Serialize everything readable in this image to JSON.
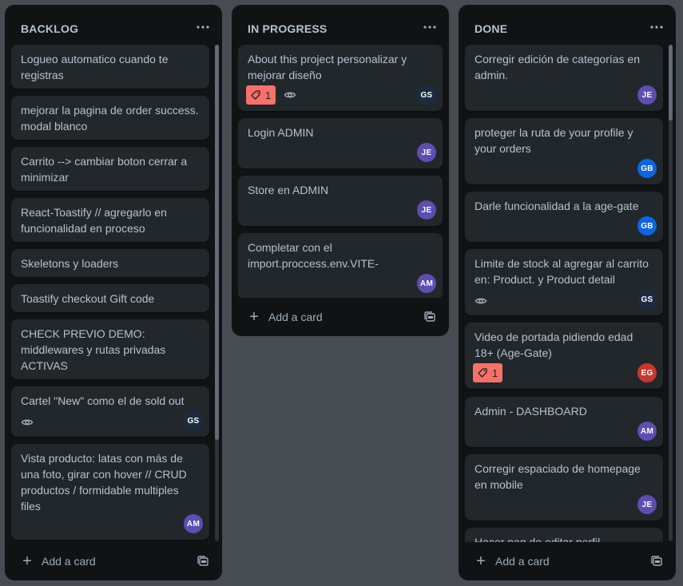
{
  "colors": {
    "board_bg": "#474c52",
    "list_bg": "#101214",
    "card_bg": "#22272b",
    "text": "#b6c2cf",
    "vote_badge": "#f87168"
  },
  "lists": [
    {
      "title": "BACKLOG",
      "menu_icon": "ellipsis-icon",
      "add_label": "Add a card",
      "cards": [
        {
          "title": "Logueo automatico cuando te registras"
        },
        {
          "title": "mejorar la pagina de order success. modal blanco"
        },
        {
          "title": "Carrito --> cambiar boton cerrar a minimizar"
        },
        {
          "title": "React-Toastify // agregarlo en funcionalidad en proceso"
        },
        {
          "title": "Skeletons y loaders"
        },
        {
          "title": "Toastify checkout Gift code"
        },
        {
          "title": "CHECK PREVIO DEMO: middlewares y rutas privadas ACTIVAS"
        },
        {
          "title": "Cartel \"New\" como el de sold out",
          "watch": true,
          "avatar": "GS"
        },
        {
          "title": "Vista producto: latas con más de una foto, girar con hover // CRUD productos / formidable multiples files",
          "avatar": "AM"
        }
      ]
    },
    {
      "title": "IN PROGRESS",
      "menu_icon": "ellipsis-icon",
      "add_label": "Add a card",
      "cards": [
        {
          "title": "About this project personalizar y mejorar diseño",
          "votes": "1",
          "watch": true,
          "avatar": "GS"
        },
        {
          "title": "Login ADMIN",
          "avatar": "JE"
        },
        {
          "title": "Store en ADMIN",
          "avatar": "JE"
        },
        {
          "title": "Completar con el import.proccess.env.VITE-",
          "avatar": "AM"
        }
      ]
    },
    {
      "title": "DONE",
      "menu_icon": "ellipsis-icon",
      "add_label": "Add a card",
      "cards": [
        {
          "title": "Corregir edición de categorías en admin.",
          "avatar": "JE"
        },
        {
          "title": "proteger la ruta de your profile y your orders",
          "avatar": "GB"
        },
        {
          "title": "Darle funcionalidad a la age-gate",
          "avatar": "GB"
        },
        {
          "title": "Limite de stock al agregar al carrito en: Product. y Product detail",
          "watch": true,
          "avatar": "GS"
        },
        {
          "title": "Video de portada pidiendo edad 18+ (Age-Gate)",
          "votes": "1",
          "avatar": "EG"
        },
        {
          "title": "Admin - DASHBOARD",
          "avatar": "AM"
        },
        {
          "title": "Corregir espaciado de homepage en mobile",
          "avatar": "JE"
        },
        {
          "title": "Hacer pag de editar perfil"
        }
      ]
    }
  ],
  "avatar_colors": {
    "GS": "#1c2b41",
    "JE": "#5e4db2",
    "AM": "#5e4db2",
    "GB": "#0c66e4",
    "EG": "#c9372c"
  }
}
